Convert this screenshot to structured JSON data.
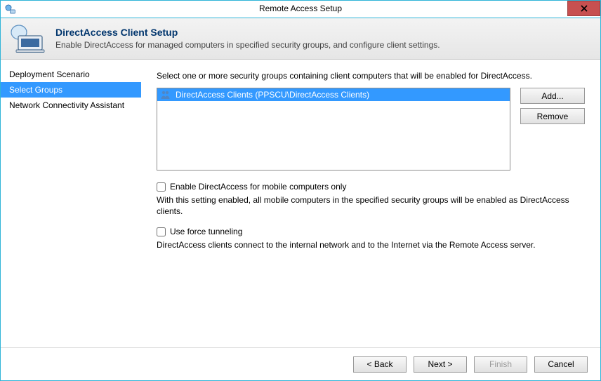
{
  "window": {
    "title": "Remote Access Setup"
  },
  "header": {
    "title": "DirectAccess Client Setup",
    "description": "Enable DirectAccess for managed computers in specified security groups, and configure client settings."
  },
  "sidebar": {
    "items": [
      {
        "label": "Deployment Scenario",
        "selected": false
      },
      {
        "label": "Select Groups",
        "selected": true
      },
      {
        "label": "Network Connectivity Assistant",
        "selected": false
      }
    ]
  },
  "main": {
    "instruction": "Select one or more security groups containing client computers that will be enabled for DirectAccess.",
    "groups": [
      {
        "label": "DirectAccess Clients (PPSCU\\DirectAccess Clients)",
        "selected": true
      }
    ],
    "buttons": {
      "add_label": "Add...",
      "remove_label": "Remove"
    },
    "mobile_checkbox_label": "Enable DirectAccess for mobile computers only",
    "mobile_help": "With this setting enabled, all mobile computers in the specified security groups will be enabled as DirectAccess clients.",
    "force_checkbox_label": "Use force tunneling",
    "force_help": "DirectAccess clients connect to the internal network and to the Internet via the Remote Access server."
  },
  "footer": {
    "back_label": "< Back",
    "next_label": "Next >",
    "finish_label": "Finish",
    "cancel_label": "Cancel"
  }
}
